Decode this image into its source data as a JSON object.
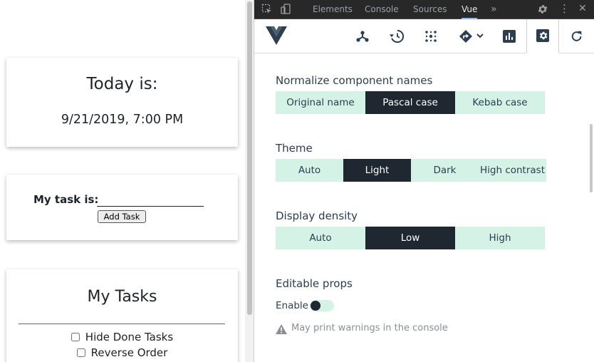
{
  "app": {
    "date_card": {
      "title": "Today is:",
      "datetime": "9/21/2019, 7:00 PM"
    },
    "task_form": {
      "label": "My task is:",
      "input_value": "",
      "button_label": "Add Task"
    },
    "tasks_card": {
      "title": "My Tasks",
      "hide_done_label": "Hide Done Tasks",
      "reverse_order_label": "Reverse Order"
    }
  },
  "devtools": {
    "tabs": [
      {
        "label": "Elements"
      },
      {
        "label": "Console"
      },
      {
        "label": "Sources"
      },
      {
        "label": "Vue",
        "active": true
      }
    ],
    "overflow_label": "»",
    "toolbar": {
      "buttons": [
        "components-icon",
        "history-icon",
        "events-icon",
        "routing-icon",
        "performance-icon",
        "settings-icon",
        "refresh-icon"
      ],
      "active": "settings-icon"
    },
    "settings": {
      "component_names": {
        "label": "Normalize component names",
        "options": [
          "Original name",
          "Pascal case",
          "Kebab case"
        ],
        "selected": "Pascal case"
      },
      "theme": {
        "label": "Theme",
        "options": [
          "Auto",
          "Light",
          "Dark",
          "High contrast"
        ],
        "selected": "Light"
      },
      "density": {
        "label": "Display density",
        "options": [
          "Auto",
          "Low",
          "High"
        ],
        "selected": "Low"
      },
      "editable_props": {
        "label": "Editable props",
        "enable_label": "Enable",
        "enabled": false,
        "warning": "May print warnings in the console"
      }
    }
  },
  "colors": {
    "accent_light": "#d4f3e6",
    "accent_dark": "#1f2831",
    "devtools_bar": "#282828",
    "text": "#2c3e50"
  }
}
